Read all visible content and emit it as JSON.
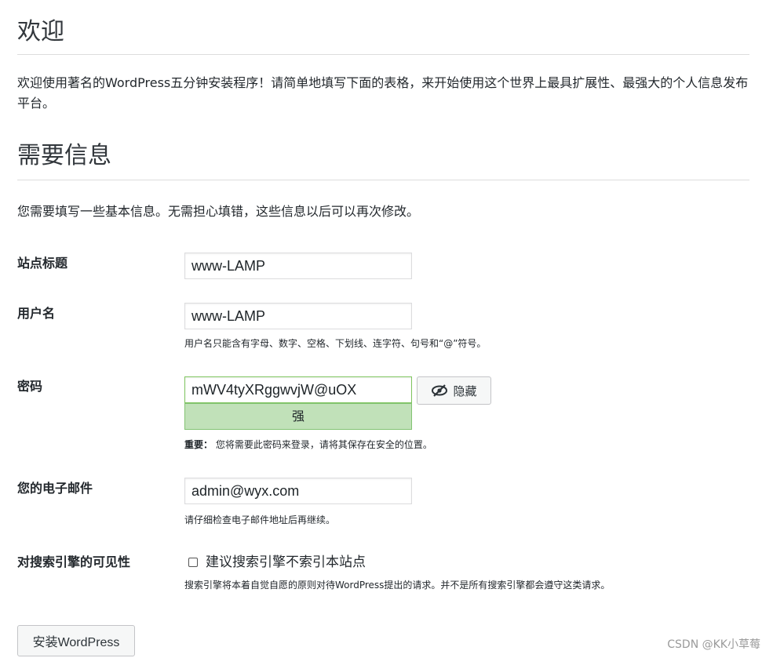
{
  "welcome": {
    "title": "欢迎",
    "intro": "欢迎使用著名的WordPress五分钟安装程序！请简单地填写下面的表格，来开始使用这个世界上最具扩展性、最强大的个人信息发布平台。"
  },
  "info": {
    "title": "需要信息",
    "description": "您需要填写一些基本信息。无需担心填错，这些信息以后可以再次修改。"
  },
  "form": {
    "site_title": {
      "label": "站点标题",
      "value": "www-LAMP"
    },
    "username": {
      "label": "用户名",
      "value": "www-LAMP",
      "hint": "用户名只能含有字母、数字、空格、下划线、连字符、句号和“@”符号。"
    },
    "password": {
      "label": "密码",
      "value": "mWV4tyXRggwvjW@uOX",
      "hide_label": "隐藏",
      "strength": "强",
      "hint_strong": "重要：",
      "hint": "您将需要此密码来登录，请将其保存在安全的位置。"
    },
    "email": {
      "label": "您的电子邮件",
      "value": "admin@wyx.com",
      "hint": "请仔细检查电子邮件地址后再继续。"
    },
    "visibility": {
      "label": "对搜索引擎的可见性",
      "checkbox_label": "建议搜索引擎不索引本站点",
      "checked": false,
      "hint": "搜索引擎将本着自觉自愿的原则对待WordPress提出的请求。并不是所有搜索引擎都会遵守这类请求。"
    }
  },
  "install_button": "安装WordPress",
  "watermark": "CSDN @KK小草莓",
  "icons": {
    "hide": "eye-slash-icon"
  },
  "colors": {
    "strength_bg": "#c1e1b9",
    "strength_border": "#83c373"
  }
}
